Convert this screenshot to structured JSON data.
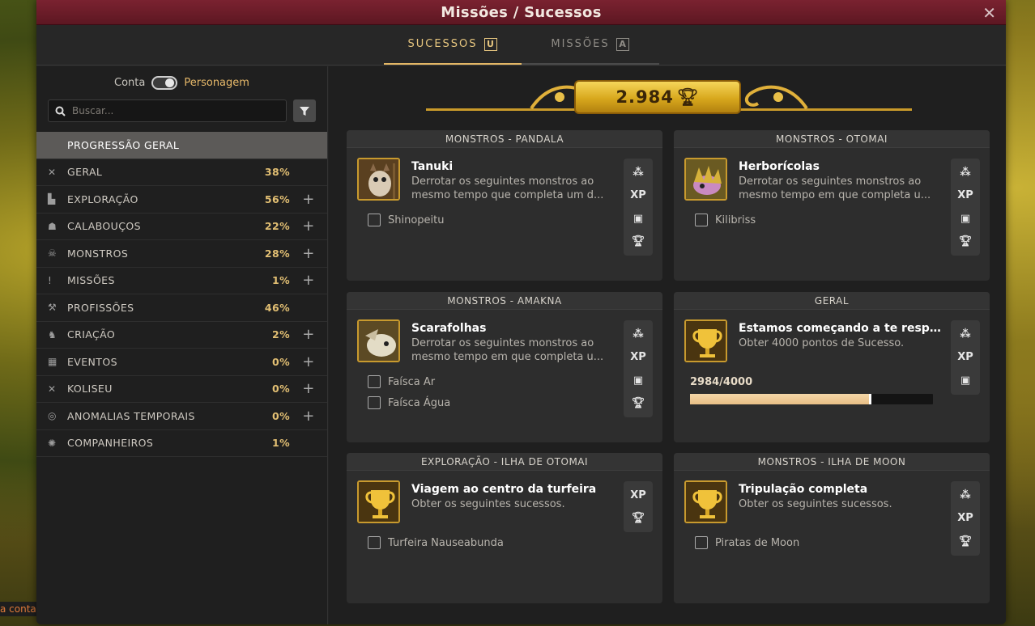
{
  "window": {
    "title": "Missões / Sucessos",
    "close_label": "✕"
  },
  "background": {
    "partial_text": "a conta"
  },
  "tabs": [
    {
      "label": "SUCESSOS",
      "key": "U",
      "active": true
    },
    {
      "label": "MISSÕES",
      "key": "A",
      "active": false
    }
  ],
  "sidebar": {
    "toggle_left": "Conta",
    "toggle_right": "Personagem",
    "search_placeholder": "Buscar...",
    "selected_label": "PROGRESSÃO GERAL",
    "items": [
      {
        "icon": "swords-icon",
        "label": "GERAL",
        "pct": "38%",
        "plus": ""
      },
      {
        "icon": "boot-icon",
        "label": "EXPLORAÇÃO",
        "pct": "56%",
        "plus": "+"
      },
      {
        "icon": "dungeon-icon",
        "label": "CALABOUÇOS",
        "pct": "22%",
        "plus": "+"
      },
      {
        "icon": "monster-icon",
        "label": "MONSTROS",
        "pct": "28%",
        "plus": "+"
      },
      {
        "icon": "exclamation-icon",
        "label": "MISSÕES",
        "pct": "1%",
        "plus": "+"
      },
      {
        "icon": "hammer-icon",
        "label": "PROFISSÕES",
        "pct": "46%",
        "plus": ""
      },
      {
        "icon": "creature-icon",
        "label": "CRIAÇÃO",
        "pct": "2%",
        "plus": "+"
      },
      {
        "icon": "calendar-icon",
        "label": "EVENTOS",
        "pct": "0%",
        "plus": "+"
      },
      {
        "icon": "swords-icon",
        "label": "KOLISEU",
        "pct": "0%",
        "plus": "+"
      },
      {
        "icon": "spiral-icon",
        "label": "ANOMALIAS TEMPORAIS",
        "pct": "0%",
        "plus": "+"
      },
      {
        "icon": "companion-icon",
        "label": "COMPANHEIROS",
        "pct": "1%",
        "plus": ""
      }
    ]
  },
  "score": {
    "value": "2.984"
  },
  "cards": [
    {
      "header": "MONSTROS - PANDALA",
      "title": "Tanuki",
      "desc": "Derrotar os seguintes monstros ao mesmo tempo que completa um d...",
      "objectives": [
        "Shinopeitu"
      ],
      "rewards": [
        "kamas",
        "XP",
        "chest",
        "trophy"
      ]
    },
    {
      "header": "MONSTROS - OTOMAI",
      "title": "Herborícolas",
      "desc": "Derrotar os seguintes monstros ao mesmo tempo em que completa u...",
      "objectives": [
        "Kilibriss"
      ],
      "rewards": [
        "kamas",
        "XP",
        "chest",
        "trophy"
      ]
    },
    {
      "header": "MONSTROS - AMAKNA",
      "title": "Scarafolhas",
      "desc": "Derrotar os seguintes monstros ao mesmo tempo em que completa u...",
      "objectives": [
        "Faísca Ar",
        "Faísca Água"
      ],
      "rewards": [
        "kamas",
        "XP",
        "chest",
        "trophy"
      ]
    },
    {
      "header": "GERAL",
      "title": "Estamos começando a te resp...",
      "desc": "Obter 4000 pontos de Sucesso.",
      "progress_text": "2984/4000",
      "progress": 0.746,
      "rewards": [
        "kamas",
        "XP",
        "chest"
      ]
    },
    {
      "header": "EXPLORAÇÃO - ILHA DE OTOMAI",
      "title": "Viagem ao centro da turfeira",
      "desc": "Obter os seguintes sucessos.",
      "objectives": [
        "Turfeira Nauseabunda"
      ],
      "rewards": [
        "XP",
        "trophy"
      ]
    },
    {
      "header": "MONSTROS - ILHA DE MOON",
      "title": "Tripulação completa",
      "desc": "Obter os seguintes sucessos.",
      "objectives": [
        "Piratas de Moon"
      ],
      "rewards": [
        "kamas",
        "XP",
        "trophy"
      ]
    }
  ],
  "reward_labels": {
    "XP": "XP"
  }
}
